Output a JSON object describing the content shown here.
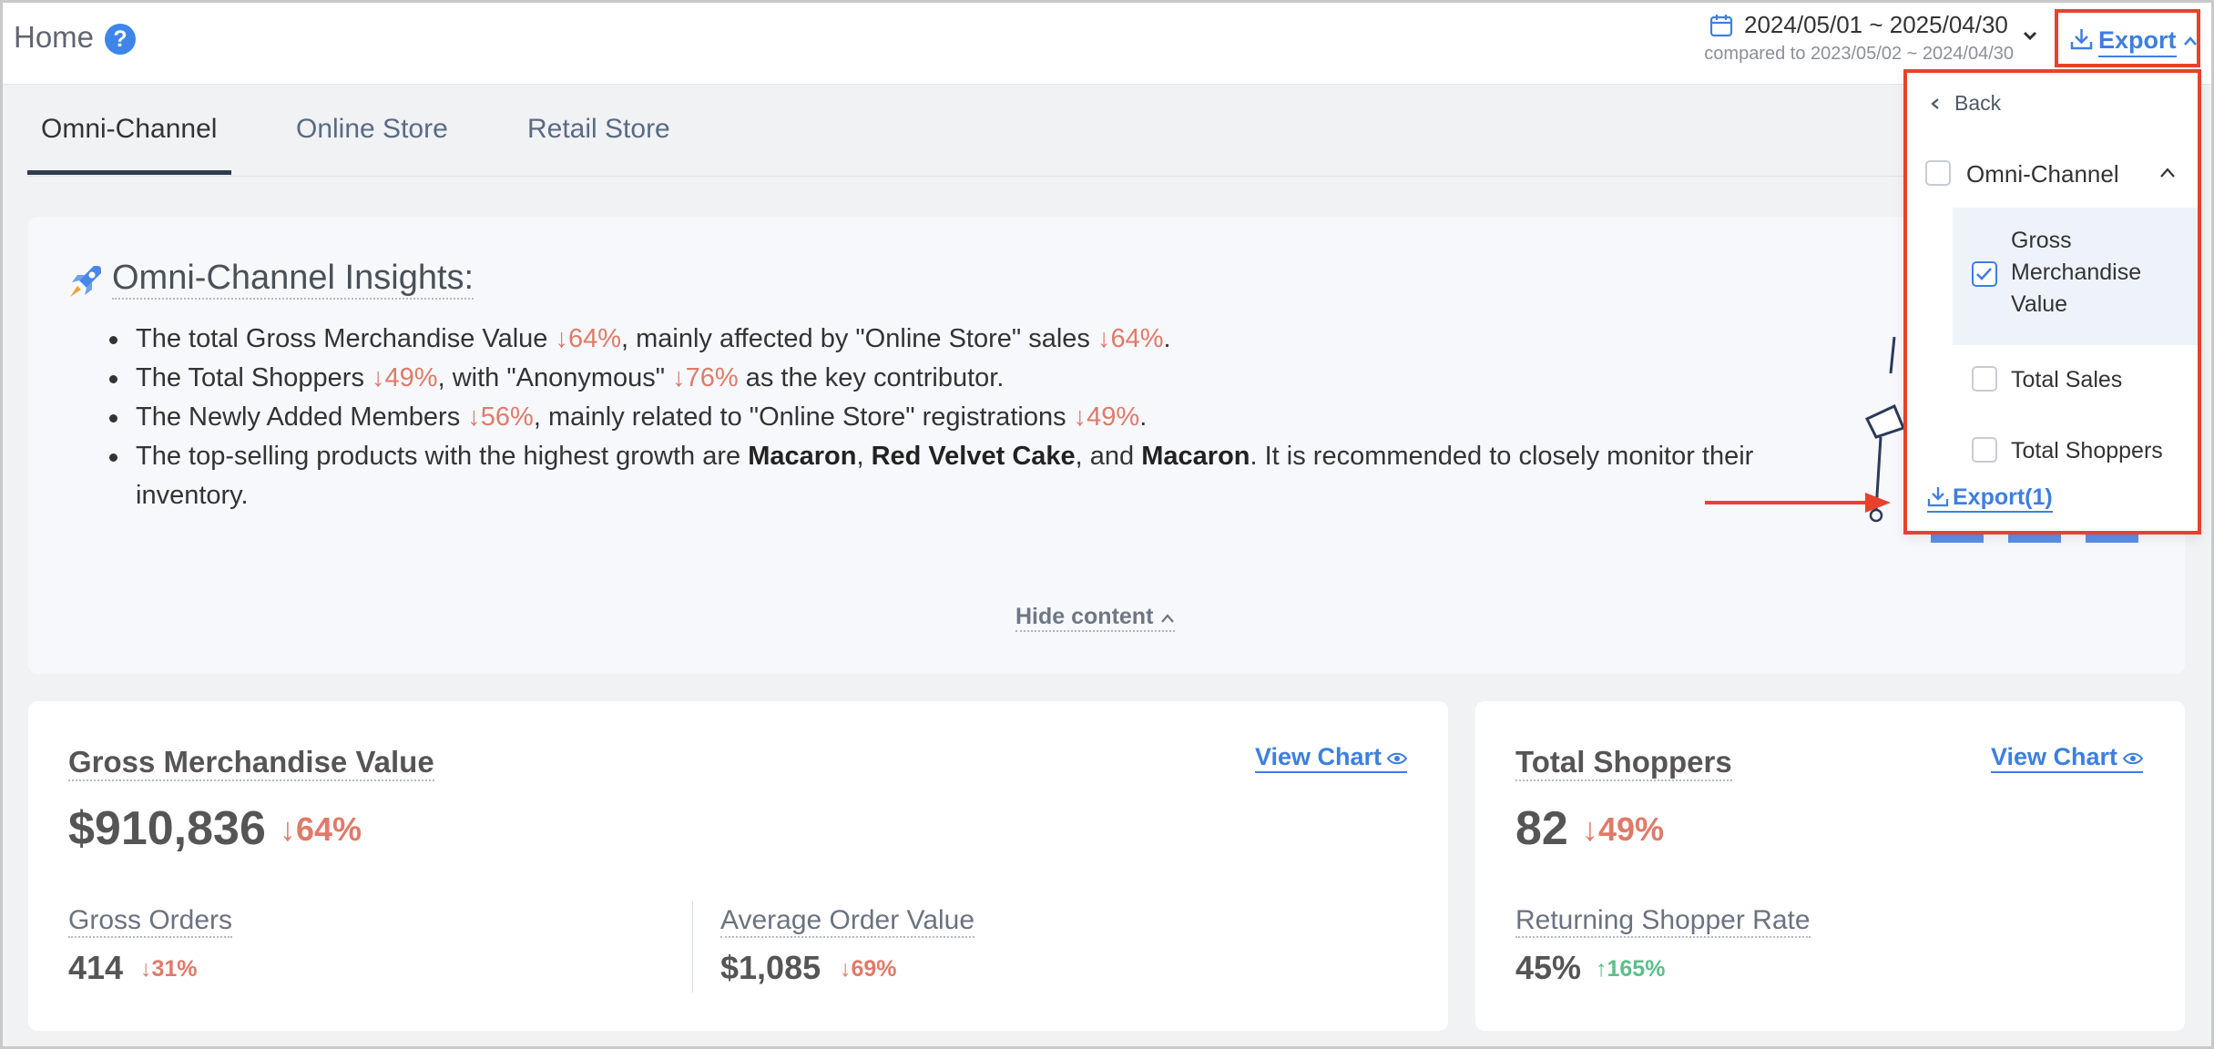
{
  "header": {
    "title": "Home",
    "help_icon": "?",
    "date_range": "2024/05/01 ~ 2025/04/30",
    "compare_text": "compared to 2023/05/02 ~ 2024/04/30",
    "export_label": "Export"
  },
  "tabs": [
    {
      "label": "Omni-Channel",
      "active": true
    },
    {
      "label": "Online Store",
      "active": false
    },
    {
      "label": "Retail Store",
      "active": false
    }
  ],
  "insights": {
    "title": "Omni-Channel Insights:",
    "hide_label": "Hide content",
    "items": [
      {
        "p1": "The total Gross Merchandise Value ",
        "d1": "↓64%",
        "p2": ", mainly affected by \"Online Store\" sales ",
        "d2": "↓64%",
        "p3": "."
      },
      {
        "p1": "The Total Shoppers ",
        "d1": "↓49%",
        "p2": ", with \"Anonymous\" ",
        "d2": "↓76%",
        "p3": " as the key contributor."
      },
      {
        "p1": "The Newly Added Members ",
        "d1": "↓56%",
        "p2": ", mainly related to \"Online Store\" registrations ",
        "d2": "↓49%",
        "p3": "."
      },
      {
        "p1": "The top-selling products with the highest growth are ",
        "b1": "Macaron",
        "p2": ", ",
        "b2": "Red Velvet Cake",
        "p3": ", and ",
        "b3": "Macaron",
        "p4": ". It is recommended to closely monitor their inventory."
      }
    ]
  },
  "cards": {
    "gmv": {
      "title": "Gross Merchandise Value",
      "view_chart": "View Chart",
      "value": "$910,836",
      "delta": "↓64%",
      "sub": [
        {
          "label": "Gross Orders",
          "value": "414",
          "delta": "↓31%"
        },
        {
          "label": "Average Order Value",
          "value": "$1,085",
          "delta": "↓69%"
        }
      ]
    },
    "shoppers": {
      "title": "Total Shoppers",
      "view_chart": "View Chart",
      "value": "82",
      "delta": "↓49%",
      "sub": [
        {
          "label": "Returning Shopper Rate",
          "value": "45%",
          "delta": "↑165%"
        }
      ]
    }
  },
  "export_menu": {
    "back_label": "Back",
    "group_label": "Omni-Channel",
    "items": [
      {
        "label": "Gross Merchandise Value",
        "checked": true
      },
      {
        "label": "Total Sales",
        "checked": false
      },
      {
        "label": "Total Shoppers",
        "checked": false
      }
    ],
    "export_label": "Export(1)"
  },
  "colors": {
    "accent": "#3d7fe0",
    "down": "#e07a68",
    "up": "#5bbf8a",
    "highlight_border": "#e8412c"
  }
}
